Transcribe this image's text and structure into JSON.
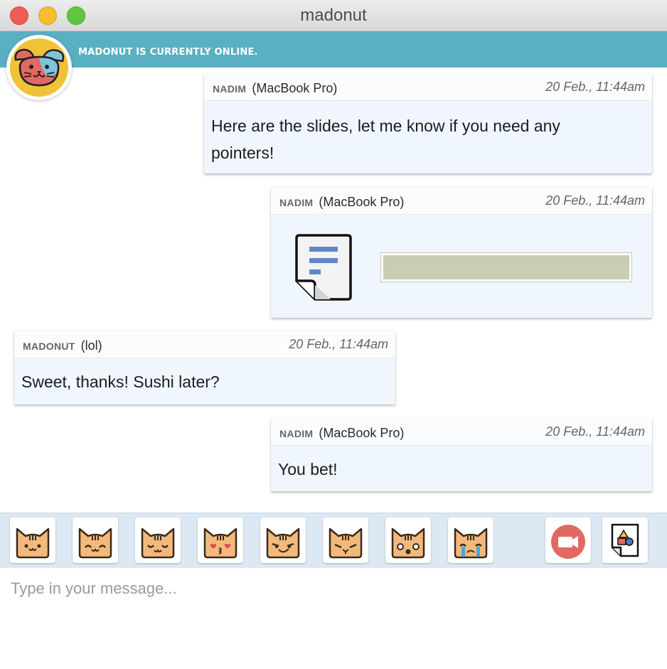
{
  "window": {
    "title": "madonut"
  },
  "status": {
    "text": "MADONUT IS CURRENTLY ONLINE."
  },
  "messages": [
    {
      "sender": "NADIM",
      "device": "(MacBook Pro)",
      "time": "20 Feb., 11:44am",
      "text": "Here are the slides, let me know if you need any pointers!"
    },
    {
      "sender": "NADIM",
      "device": "(MacBook Pro)",
      "time": "20 Feb., 11:44am",
      "attachment_icon": "document-icon"
    },
    {
      "sender": "MADONUT",
      "device": "(lol)",
      "time": "20 Feb., 11:44am",
      "text": "Sweet, thanks! Sushi later?"
    },
    {
      "sender": "NADIM",
      "device": "(MacBook Pro)",
      "time": "20 Feb., 11:44am",
      "text": "You bet!"
    }
  ],
  "toolbar": {
    "emojis": [
      "cat-smile-icon",
      "cat-happy-icon",
      "cat-content-icon",
      "cat-kiss-icon",
      "cat-smirk-icon",
      "cat-angry-icon",
      "cat-surprised-icon",
      "cat-crying-icon"
    ],
    "video_icon": "video-camera-icon",
    "file_icon": "send-file-icon"
  },
  "composer": {
    "placeholder": "Type in your message..."
  },
  "colors": {
    "status_bar": "#59b0c2",
    "message_bg": "#f0f6fd",
    "toolbar_bg": "#dce9f4",
    "cat": "#f3b97c",
    "video_button": "#e06961",
    "avatar_bg": "#f0c237"
  }
}
